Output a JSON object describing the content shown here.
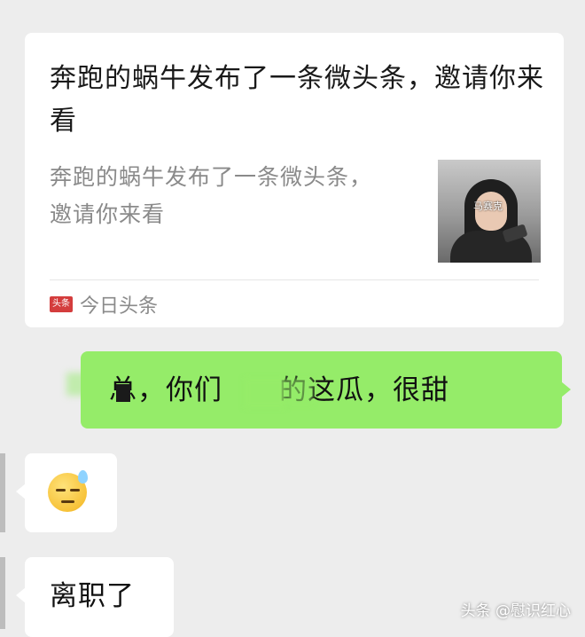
{
  "shared_card": {
    "title": "奔跑的蜗牛发布了一条微头条，邀请你来看",
    "description": "奔跑的蜗牛发布了一条微头条，邀请你来看",
    "thumbnail_caption": "马赛克",
    "source_icon_text": "头条",
    "source_name": "今日头条"
  },
  "messages": {
    "outgoing_text": "总，你们　　的这瓜，很甜",
    "incoming_emoji": "sweat-expressionless-face",
    "incoming_text": "离职了"
  },
  "watermark": "头条 @慰识红心",
  "colors": {
    "background": "#ededed",
    "outgoing_bubble": "#95ec69",
    "incoming_bubble": "#ffffff",
    "source_icon": "#d43d3d"
  }
}
